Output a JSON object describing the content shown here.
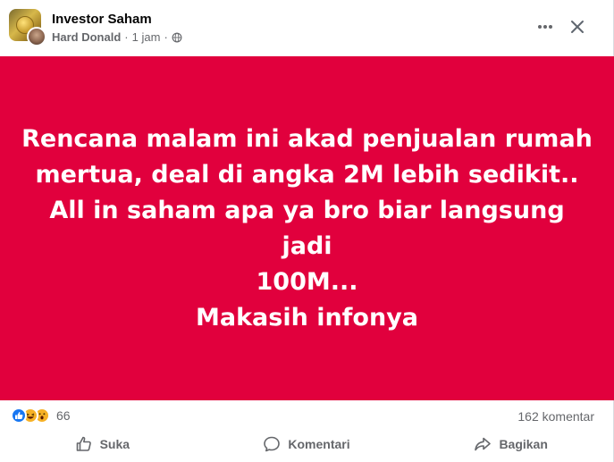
{
  "post": {
    "group_name": "Investor Saham",
    "author": "Hard Donald",
    "separator": "·",
    "time": "1 jam",
    "privacy_icon": "globe-icon",
    "banner_text": "Rencana malam ini akad penjualan rumah\nmertua, deal di angka 2M lebih sedikit..\nAll in saham apa ya bro biar langsung jadi\n100M...\nMakasih infonya",
    "banner_color": "#e1003d",
    "reaction_count": "66",
    "comment_count": "162 komentar"
  },
  "actions": {
    "like_label": "Suka",
    "comment_label": "Komentari",
    "share_label": "Bagikan"
  },
  "icons": {
    "more": "more-horizontal-icon",
    "close": "close-icon",
    "reactions": [
      "like-reaction-icon",
      "haha-reaction-icon",
      "wow-reaction-icon"
    ]
  }
}
